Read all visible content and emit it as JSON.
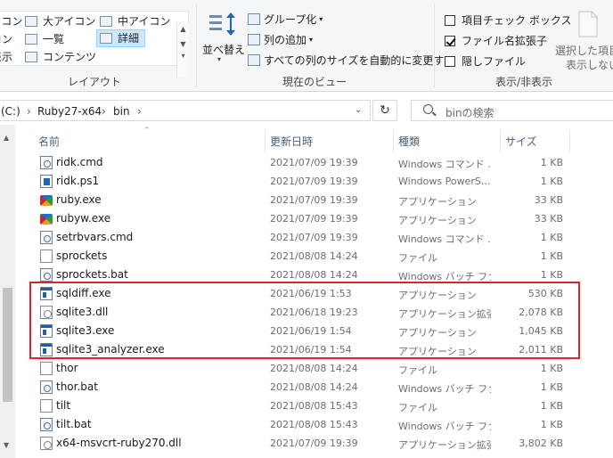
{
  "ribbon": {
    "layout": {
      "items": [
        {
          "label": "アイコン",
          "selected": false
        },
        {
          "label": "大アイコン",
          "selected": false
        },
        {
          "label": "中アイコン",
          "selected": false
        },
        {
          "label": "コン",
          "selected": false
        },
        {
          "label": "一覧",
          "selected": false
        },
        {
          "label": "詳細",
          "selected": true
        },
        {
          "label": "表示",
          "selected": false
        },
        {
          "label": "コンテンツ",
          "selected": false
        }
      ],
      "group_label": "レイアウト"
    },
    "current_view": {
      "sort_label": "並べ替え",
      "group_by_label": "グループ化",
      "add_column_label": "列の追加",
      "resize_columns_label": "すべての列のサイズを自動的に変更する",
      "group_label": "現在のビュー"
    },
    "show_hide": {
      "item_checkbox_label": "項目チェック ボックス",
      "item_checkbox_checked": false,
      "file_ext_label": "ファイル名拡張子",
      "file_ext_checked": true,
      "hidden_files_label": "隠しファイル",
      "hidden_files_checked": false,
      "hide_selected_label_1": "選択した項目",
      "hide_selected_label_2": "表示しない",
      "group_label": "表示/非表示"
    }
  },
  "address": {
    "crumbs": [
      "(C:)",
      "Ruby27-x64",
      "bin"
    ],
    "search_placeholder": "binの検索"
  },
  "columns": {
    "name": "名前",
    "date": "更新日時",
    "type": "種類",
    "size": "サイズ"
  },
  "files": [
    {
      "name": "ridk.cmd",
      "date": "2021/07/09 19:39",
      "type": "Windows コマンド ...",
      "size": "1 KB",
      "icon": "config-file-icon"
    },
    {
      "name": "ridk.ps1",
      "date": "2021/07/09 19:39",
      "type": "Windows PowerS...",
      "size": "1 KB",
      "icon": "powershell-file-icon"
    },
    {
      "name": "ruby.exe",
      "date": "2021/07/09 19:39",
      "type": "アプリケーション",
      "size": "33 KB",
      "icon": "ruby-icon"
    },
    {
      "name": "rubyw.exe",
      "date": "2021/07/09 19:39",
      "type": "アプリケーション",
      "size": "33 KB",
      "icon": "ruby-icon"
    },
    {
      "name": "setrbvars.cmd",
      "date": "2021/07/09 19:39",
      "type": "Windows コマンド ...",
      "size": "1 KB",
      "icon": "config-file-icon"
    },
    {
      "name": "sprockets",
      "date": "2021/08/08 14:24",
      "type": "ファイル",
      "size": "1 KB",
      "icon": "file-icon"
    },
    {
      "name": "sprockets.bat",
      "date": "2021/08/08 14:24",
      "type": "Windows バッチ ファ...",
      "size": "1 KB",
      "icon": "config-file-icon"
    },
    {
      "name": "sqldiff.exe",
      "date": "2021/06/19 1:53",
      "type": "アプリケーション",
      "size": "530 KB",
      "icon": "exe-icon"
    },
    {
      "name": "sqlite3.dll",
      "date": "2021/06/18 19:23",
      "type": "アプリケーション拡張",
      "size": "2,078 KB",
      "icon": "dll-icon"
    },
    {
      "name": "sqlite3.exe",
      "date": "2021/06/19 1:54",
      "type": "アプリケーション",
      "size": "1,045 KB",
      "icon": "exe-icon"
    },
    {
      "name": "sqlite3_analyzer.exe",
      "date": "2021/06/19 1:54",
      "type": "アプリケーション",
      "size": "2,011 KB",
      "icon": "exe-icon"
    },
    {
      "name": "thor",
      "date": "2021/08/08 14:24",
      "type": "ファイル",
      "size": "1 KB",
      "icon": "file-icon"
    },
    {
      "name": "thor.bat",
      "date": "2021/08/08 14:24",
      "type": "Windows バッチ ファ...",
      "size": "1 KB",
      "icon": "config-file-icon"
    },
    {
      "name": "tilt",
      "date": "2021/08/08 15:43",
      "type": "ファイル",
      "size": "1 KB",
      "icon": "file-icon"
    },
    {
      "name": "tilt.bat",
      "date": "2021/08/08 15:43",
      "type": "Windows バッチ ファ...",
      "size": "1 KB",
      "icon": "config-file-icon"
    },
    {
      "name": "x64-msvcrt-ruby270.dll",
      "date": "2021/07/09 19:39",
      "type": "アプリケーション拡張",
      "size": "3,802 KB",
      "icon": "dll-icon"
    }
  ],
  "highlight_color": "#e0202a"
}
